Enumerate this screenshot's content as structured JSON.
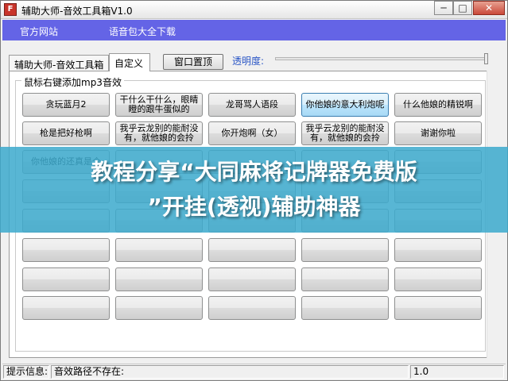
{
  "window": {
    "title": "辅助大师-音效工具箱V1.0",
    "icon_glyph": "F",
    "minimize_glyph": "─",
    "maximize_glyph": "□",
    "close_glyph": "✕"
  },
  "menubar": {
    "items": [
      "官方网站",
      "语音包大全下载"
    ],
    "color": "#6464e6"
  },
  "tabs": [
    {
      "label": "辅助大师-音效工具箱",
      "active": false
    },
    {
      "label": "自定义",
      "active": true
    }
  ],
  "toolbar": {
    "pin_button": "窗口置顶",
    "opacity_label": "透明度:",
    "opacity_value": 1.0
  },
  "group": {
    "title": "鼠标右键添加mp3音效"
  },
  "buttons": [
    [
      "贪玩蓝月2",
      "干什么干什么，眼睛瞪的跟牛蛋似的",
      "龙哥骂人语段",
      "你他娘的意大利炮呢",
      "什么他娘的精锐啊"
    ],
    [
      "枪是把好枪啊",
      "我乎云龙别的能耐没有，就他娘的会拎",
      "你开炮啊（女）",
      "我乎云龙别的能耐没有，就他娘的会拎",
      "谢谢你啦"
    ],
    [
      "你他娘的还真是个",
      "",
      "",
      "",
      ""
    ],
    [
      "",
      "",
      "",
      "",
      ""
    ],
    [
      "",
      "",
      "",
      "",
      ""
    ],
    [
      "",
      "",
      "",
      "",
      ""
    ],
    [
      "",
      "",
      "",
      "",
      ""
    ],
    [
      "",
      "",
      "",
      "",
      ""
    ]
  ],
  "statusbar": {
    "label": "提示信息:",
    "message": "音效路径不存在:",
    "version": "1.0"
  },
  "overlay": {
    "line1": "教程分享“大同麻将记牌器免费版",
    "line2": "”开挂(透视)辅助神器",
    "color": "#3caacd"
  }
}
